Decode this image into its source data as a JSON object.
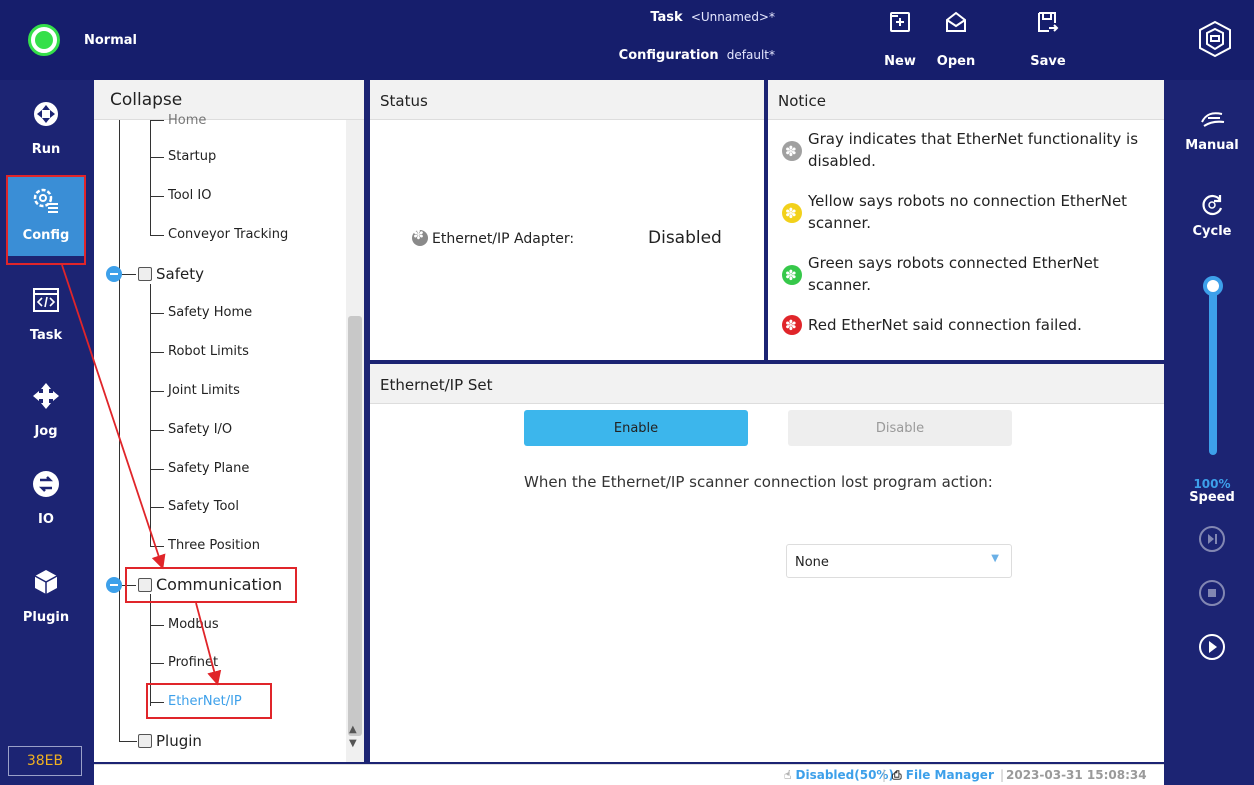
{
  "topbar": {
    "state_label": "Normal",
    "task_key": "Task",
    "task_value": "<Unnamed>*",
    "configuration_key": "Configuration",
    "configuration_value": "default*",
    "buttons": {
      "new": "New",
      "open": "Open",
      "save": "Save"
    }
  },
  "leftnav": {
    "items": [
      {
        "label": "Run",
        "icon": "run-icon"
      },
      {
        "label": "Config",
        "icon": "config-icon"
      },
      {
        "label": "Task",
        "icon": "task-code-icon"
      },
      {
        "label": "Jog",
        "icon": "jog-arrows-icon"
      },
      {
        "label": "IO",
        "icon": "io-icon"
      },
      {
        "label": "Plugin",
        "icon": "plugin-cube-icon"
      }
    ],
    "active": "Config",
    "version": "38EB"
  },
  "rightnav": {
    "manual": "Manual",
    "cycle": "Cycle",
    "speed_pct": "100%",
    "speed_label": "Speed",
    "speed_value": 1.0
  },
  "tree": {
    "header": "Collapse",
    "partial_top": "Home",
    "config_leaves": [
      "Startup",
      "Tool IO",
      "Conveyor Tracking"
    ],
    "safety": {
      "label": "Safety",
      "children": [
        "Safety Home",
        "Robot Limits",
        "Joint Limits",
        "Safety I/O",
        "Safety Plane",
        "Safety Tool",
        "Three Position"
      ]
    },
    "communication": {
      "label": "Communication",
      "children": [
        "Modbus",
        "Profinet",
        "EtherNet/IP"
      ],
      "selected": "EtherNet/IP"
    },
    "plugin": {
      "label": "Plugin"
    }
  },
  "status_panel": {
    "title": "Status",
    "adapter_label": "Ethernet/IP Adapter:",
    "adapter_value": "Disabled"
  },
  "notice_panel": {
    "title": "Notice",
    "items": [
      {
        "color": "#a0a0a0",
        "text": "Gray indicates that EtherNet functionality is disabled."
      },
      {
        "color": "#f2d11b",
        "text": "Yellow says robots no connection EtherNet scanner."
      },
      {
        "color": "#36c84a",
        "text": "Green says robots connected EtherNet scanner."
      },
      {
        "color": "#e0252a",
        "text": "Red EtherNet said connection failed."
      }
    ]
  },
  "set_panel": {
    "title": "Ethernet/IP Set",
    "enable_label": "Enable",
    "disable_label": "Disable",
    "lost_text": "When the Ethernet/IP scanner connection lost program action:",
    "select_value": "None"
  },
  "statusbar": {
    "mode": "Disabled(50%)",
    "file_manager": "File Manager",
    "datetime": "2023-03-31 15:08:34"
  },
  "colors": {
    "nav_bg": "#1c2473",
    "accent": "#3da0ea",
    "annotation_red": "#e0252a",
    "state_green": "#35e04a"
  }
}
